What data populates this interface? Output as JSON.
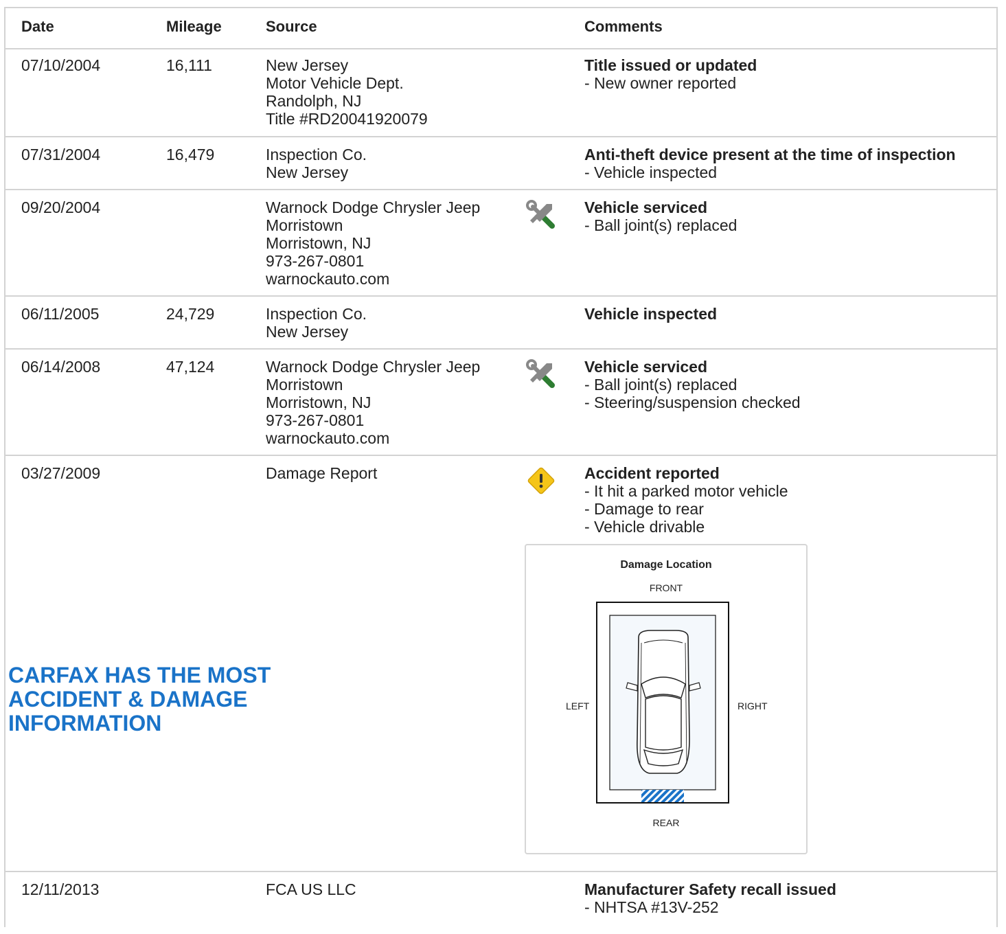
{
  "header": {
    "date": "Date",
    "mileage": "Mileage",
    "source": "Source",
    "comments": "Comments"
  },
  "rows": [
    {
      "date": "07/10/2004",
      "mileage": "16,111",
      "source": [
        "New Jersey",
        "Motor Vehicle Dept.",
        "Randolph, NJ",
        "Title #RD20041920079"
      ],
      "icon": "",
      "comment_title": "Title issued or updated",
      "comment_items": [
        "- New owner reported"
      ]
    },
    {
      "date": "07/31/2004",
      "mileage": "16,479",
      "source": [
        "Inspection Co.",
        "New Jersey"
      ],
      "icon": "",
      "comment_title": "Anti-theft device present at the time of inspection",
      "comment_items": [
        "- Vehicle inspected"
      ]
    },
    {
      "date": "09/20/2004",
      "mileage": "",
      "source": [
        "Warnock Dodge Chrysler Jeep",
        "Morristown",
        "Morristown, NJ",
        "973-267-0801",
        "warnockauto.com"
      ],
      "icon": "service-wrench-icon",
      "comment_title": "Vehicle serviced",
      "comment_items": [
        "- Ball joint(s) replaced"
      ]
    },
    {
      "date": "06/11/2005",
      "mileage": "24,729",
      "source": [
        "Inspection Co.",
        "New Jersey"
      ],
      "icon": "",
      "comment_title": "Vehicle inspected",
      "comment_items": []
    },
    {
      "date": "06/14/2008",
      "mileage": "47,124",
      "source": [
        "Warnock Dodge Chrysler Jeep",
        "Morristown",
        "Morristown, NJ",
        "973-267-0801",
        "warnockauto.com"
      ],
      "icon": "service-wrench-icon",
      "comment_title": "Vehicle serviced",
      "comment_items": [
        "- Ball joint(s) replaced",
        "- Steering/suspension checked"
      ]
    },
    {
      "date": "03/27/2009",
      "mileage": "",
      "source": [
        "Damage Report"
      ],
      "icon": "accident-warning-icon",
      "comment_title": "Accident reported",
      "comment_items": [
        "- It hit a parked motor vehicle",
        "- Damage to rear",
        "- Vehicle drivable"
      ]
    },
    {
      "date": "12/11/2013",
      "mileage": "",
      "source": [
        "FCA US LLC"
      ],
      "icon": "",
      "comment_title": "Manufacturer Safety recall issued",
      "comment_items": [
        "- NHTSA #13V-252"
      ]
    }
  ],
  "promo": {
    "lines": [
      "CARFAX HAS THE MOST",
      "ACCIDENT & DAMAGE",
      "INFORMATION"
    ],
    "color": "#1a73c8"
  },
  "damage_diagram": {
    "title": "Damage Location",
    "front": "FRONT",
    "rear": "REAR",
    "left": "LEFT",
    "right": "RIGHT",
    "damaged_area": "rear",
    "highlight_color": "#1a73c8"
  },
  "colors": {
    "border": "#d3d3d3",
    "wrench_green": "#2e7d32",
    "warning_yellow": "#f5c518"
  }
}
